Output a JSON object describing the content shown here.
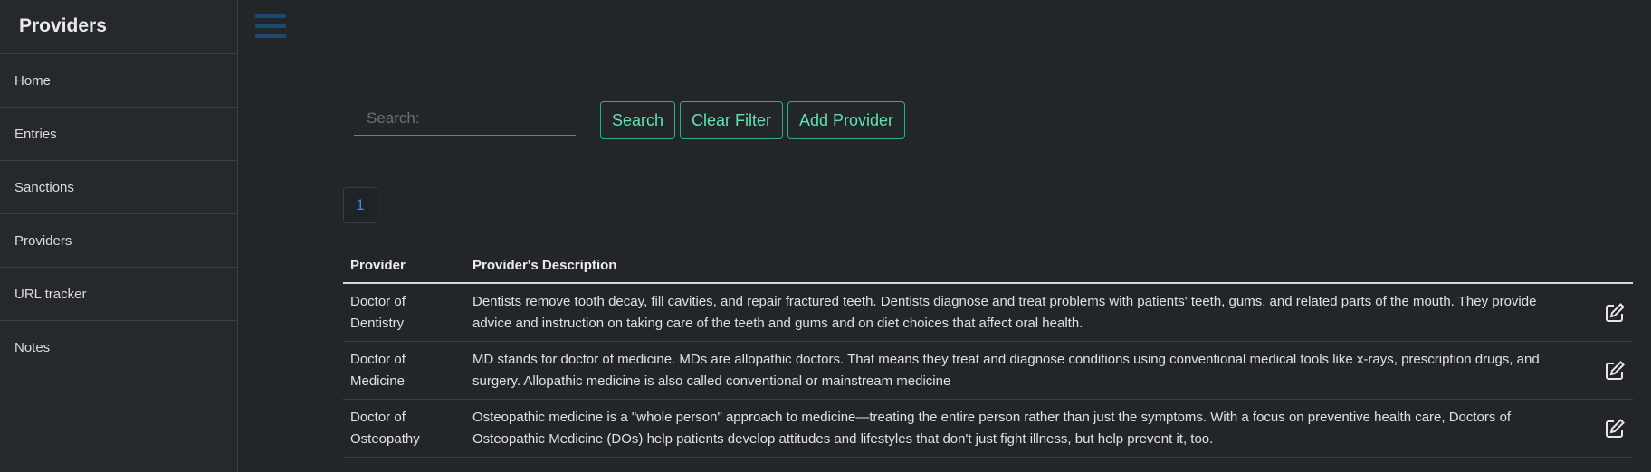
{
  "sidebar": {
    "title": "Providers",
    "items": [
      {
        "label": "Home"
      },
      {
        "label": "Entries"
      },
      {
        "label": "Sanctions"
      },
      {
        "label": "Providers"
      },
      {
        "label": "URL tracker"
      },
      {
        "label": "Notes"
      }
    ]
  },
  "toolbar": {
    "search_placeholder": "Search:",
    "search_value": "",
    "search_label": "Search",
    "clear_label": "Clear Filter",
    "add_label": "Add Provider"
  },
  "pagination": {
    "current_page": "1"
  },
  "table": {
    "headers": [
      "Provider",
      "Provider's Description"
    ],
    "rows": [
      {
        "provider": "Doctor of Dentistry",
        "description": "Dentists remove tooth decay, fill cavities, and repair fractured teeth. Dentists diagnose and treat problems with patients' teeth, gums, and related parts of the mouth. They provide advice and instruction on taking care of the teeth and gums and on diet choices that affect oral health."
      },
      {
        "provider": "Doctor of Medicine",
        "description": "MD stands for doctor of medicine. MDs are allopathic doctors. That means they treat and diagnose conditions using conventional medical tools like x-rays, prescription drugs, and surgery. Allopathic medicine is also called conventional or mainstream medicine"
      },
      {
        "provider": "Doctor of Osteopathy",
        "description": "Osteopathic medicine is a \"whole person\" approach to medicine—treating the entire person rather than just the symptoms. With a focus on preventive health care, Doctors of Osteopathic Medicine (DOs) help patients develop attitudes and lifestyles that don't just fight illness, but help prevent it, too."
      }
    ]
  },
  "icons": {
    "menu": "hamburger-menu-icon",
    "edit": "edit-icon"
  },
  "colors": {
    "accent": "#2fae85",
    "accent_text": "#5ee3b1",
    "page_link": "#2f8cf0",
    "menu_icon": "#1e4a72",
    "background": "#222628"
  }
}
